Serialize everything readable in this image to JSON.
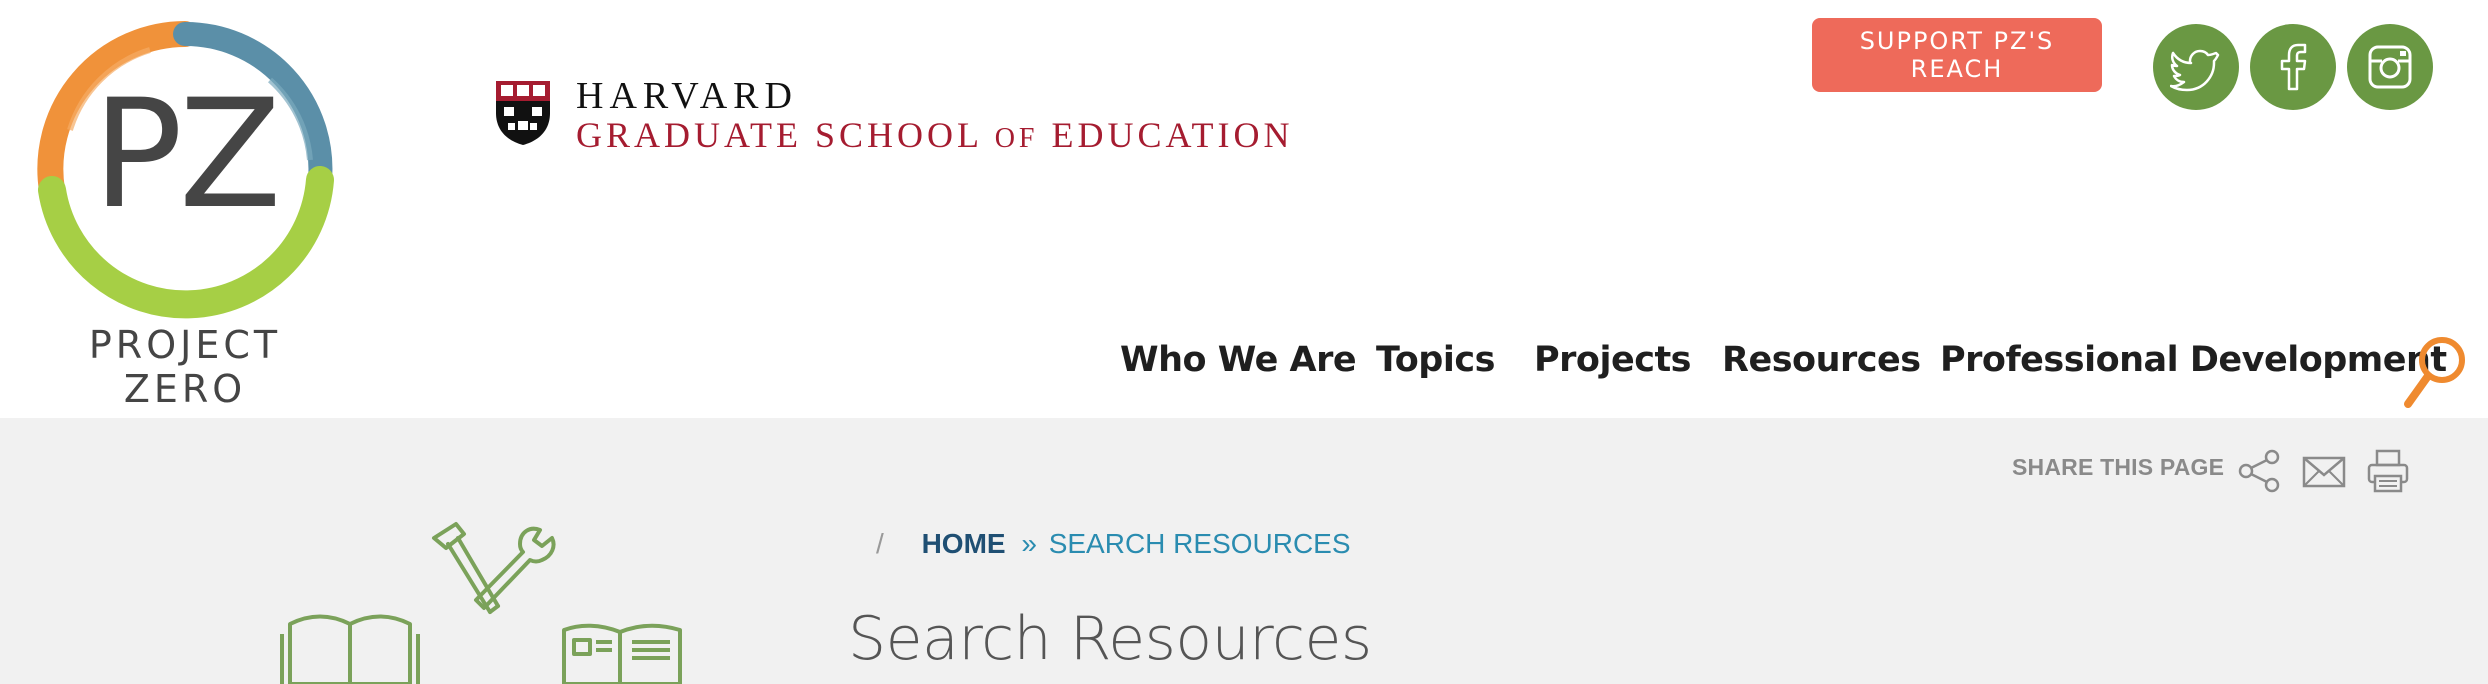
{
  "brand": {
    "logo_mark": "PZ",
    "logo_name": "PROJECT ZERO",
    "ring_colors": [
      "#f0923a",
      "#5b8fa8",
      "#a6cf45"
    ]
  },
  "partner": {
    "line1": "HARVARD",
    "line2_a": "GRADUATE SCHOOL",
    "line2_of": "OF",
    "line2_b": "EDUCATION"
  },
  "support": {
    "label": "SUPPORT PZ'S REACH"
  },
  "social": [
    {
      "name": "twitter-icon"
    },
    {
      "name": "facebook-icon"
    },
    {
      "name": "instagram-icon"
    }
  ],
  "nav": {
    "items": [
      {
        "label": "Who We Are"
      },
      {
        "label": "Topics"
      },
      {
        "label": "Projects"
      },
      {
        "label": "Resources"
      },
      {
        "label": "Professional Development"
      }
    ]
  },
  "tools": {
    "share_label": "SHARE THIS PAGE"
  },
  "breadcrumb": {
    "separator": "/",
    "home": "HOME",
    "arrow": "»",
    "current": "SEARCH RESOURCES"
  },
  "page": {
    "title": "Search Resources"
  },
  "colors": {
    "accent_green": "#6a9843",
    "support_coral": "#ee6a5a",
    "search_orange": "#ef8a2f",
    "harvard_crimson": "#a51c30",
    "link_blue": "#2a8cb0"
  }
}
